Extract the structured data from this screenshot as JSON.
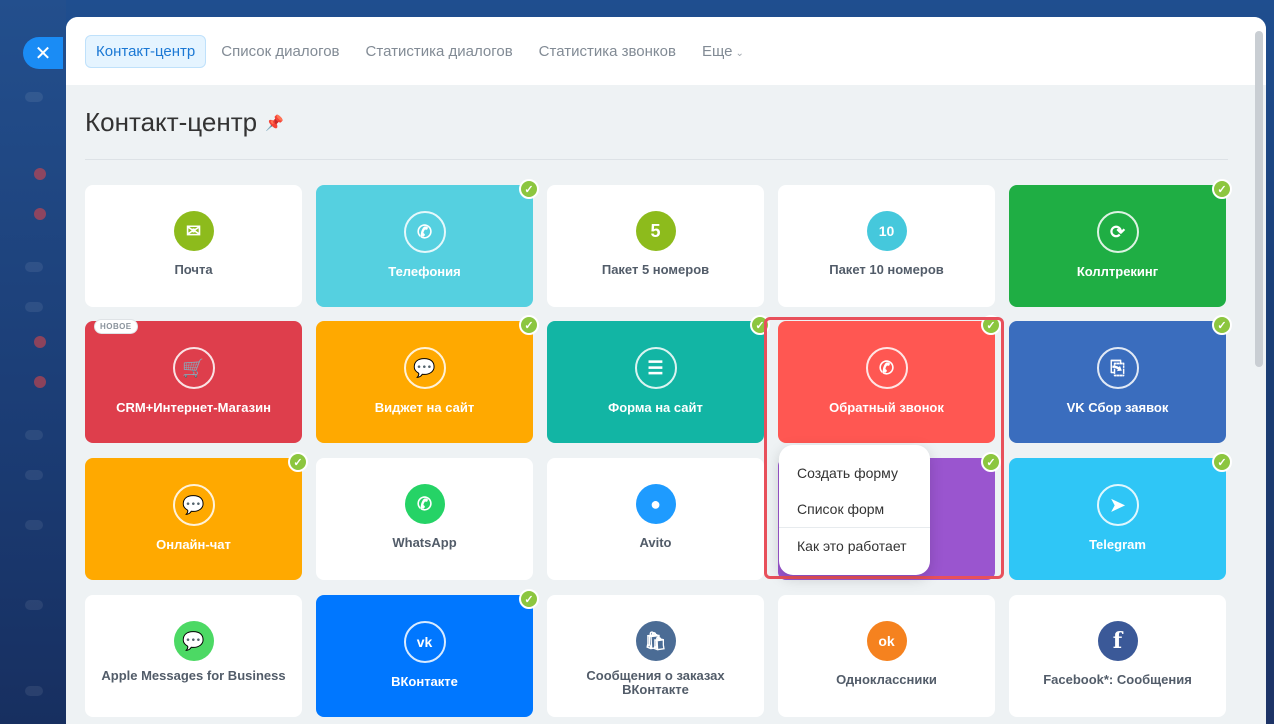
{
  "nav": {
    "tabs": [
      {
        "label": "Контакт-центр"
      },
      {
        "label": "Список диалогов"
      },
      {
        "label": "Статистика диалогов"
      },
      {
        "label": "Статистика звонков"
      },
      {
        "label": "Еще"
      }
    ]
  },
  "page": {
    "title": "Контакт-центр"
  },
  "tiles": [
    {
      "label": "Почта",
      "icon": "mail-icon",
      "bg": "#ffffff",
      "icon_color": "#8dbb1c",
      "connected": false
    },
    {
      "label": "Телефония",
      "icon": "phone-icon",
      "bg": "#55d0e0",
      "connected": true
    },
    {
      "label": "Пакет 5 номеров",
      "icon": "five-numbers-icon",
      "glyph": "5",
      "bg": "#ffffff",
      "icon_color": "#8dbb1c",
      "connected": false
    },
    {
      "label": "Пакет 10 номеров",
      "icon": "ten-numbers-icon",
      "glyph": "10",
      "bg": "#ffffff",
      "icon_color": "#45c8dc",
      "connected": false
    },
    {
      "label": "Коллтрекинг",
      "icon": "calltracking-icon",
      "bg": "#1fae44",
      "connected": true
    },
    {
      "label": "CRM+Интернет-Магазин",
      "icon": "shop-icon",
      "bg": "#de3e4c",
      "connected": false,
      "badge": "НОВОЕ"
    },
    {
      "label": "Виджет на сайт",
      "icon": "chat-widget-icon",
      "bg": "#ffa900",
      "connected": true
    },
    {
      "label": "Форма на сайт",
      "icon": "form-icon",
      "bg": "#12b5a4",
      "connected": true
    },
    {
      "label": "Обратный звонок",
      "icon": "callback-icon",
      "bg": "#ff5752",
      "connected": true
    },
    {
      "label": "VK Сбор заявок",
      "icon": "vk-leads-icon",
      "bg": "#3a6dbe",
      "connected": true
    },
    {
      "label": "Онлайн-чат",
      "icon": "online-chat-icon",
      "bg": "#ffa900",
      "connected": true
    },
    {
      "label": "WhatsApp",
      "icon": "whatsapp-icon",
      "bg": "#ffffff",
      "icon_color": "#25d366",
      "connected": false
    },
    {
      "label": "Avito",
      "icon": "avito-icon",
      "bg": "#ffffff",
      "icon_color": "#1e9bff",
      "connected": false
    },
    {
      "label": "",
      "icon": "",
      "bg": "#9a55cf",
      "connected": true
    },
    {
      "label": "Telegram",
      "icon": "telegram-icon",
      "bg": "#2fc6f6",
      "connected": true
    },
    {
      "label": "Apple Messages for Business",
      "icon": "apple-messages-icon",
      "bg": "#ffffff",
      "icon_color": "#4cd964",
      "connected": false
    },
    {
      "label": "ВКонтакте",
      "icon": "vk-icon",
      "bg": "#0077ff",
      "connected": true
    },
    {
      "label": "Сообщения о заказах ВКонтакте",
      "icon": "vk-orders-icon",
      "bg": "#ffffff",
      "icon_color": "#4b6c95",
      "connected": false
    },
    {
      "label": "Одноклассники",
      "icon": "ok-icon",
      "bg": "#ffffff",
      "icon_color": "#f5821f",
      "connected": false
    },
    {
      "label": "Facebook*: Сообщения",
      "icon": "facebook-icon",
      "bg": "#ffffff",
      "icon_color": "#3b5998",
      "connected": false
    }
  ],
  "popup": {
    "items": [
      {
        "label": "Создать форму"
      },
      {
        "label": "Список форм"
      },
      {
        "label": "Как это работает"
      }
    ]
  },
  "colors": {
    "accent": "#1b78d4",
    "check": "#8cc63f",
    "highlight": "#e8505b"
  }
}
